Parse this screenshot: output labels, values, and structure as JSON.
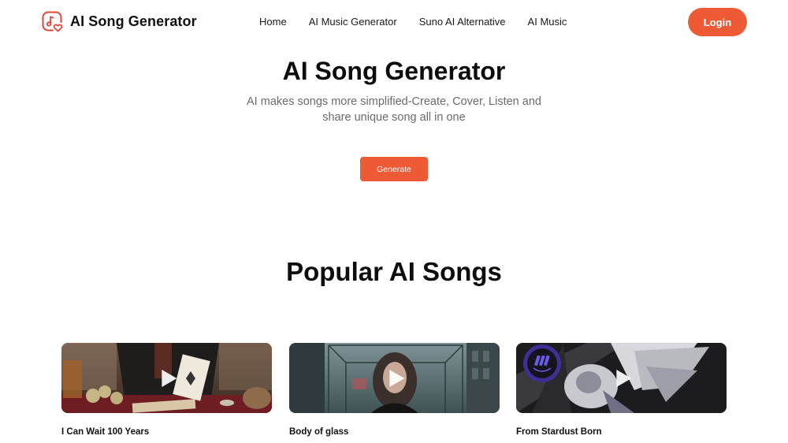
{
  "brand": {
    "name": "AI Song Generator",
    "logo_icon": "music-note-heart-icon",
    "accent_color": "#ee5a36"
  },
  "nav": {
    "items": [
      {
        "label": "Home"
      },
      {
        "label": "AI Music Generator"
      },
      {
        "label": "Suno AI Alternative"
      },
      {
        "label": "AI Music"
      }
    ],
    "login_label": "Login"
  },
  "hero": {
    "title": "AI Song Generator",
    "subtitle": "AI makes songs more simplified-Create, Cover, Listen and share unique song all in one",
    "generate_label": "Generate"
  },
  "popular": {
    "title": "Popular AI Songs",
    "songs": [
      {
        "title": "I Can Wait 100 Years",
        "thumbnail": "poker-player-holding-ace-of-spades",
        "play_icon": "play-icon"
      },
      {
        "title": "Body of glass",
        "thumbnail": "girl-in-glass-box-city-street",
        "play_icon": "play-icon"
      },
      {
        "title": "From Stardust Born",
        "thumbnail": "winged-figure-in-space-with-logo-badge",
        "play_icon": "play-icon"
      }
    ]
  }
}
